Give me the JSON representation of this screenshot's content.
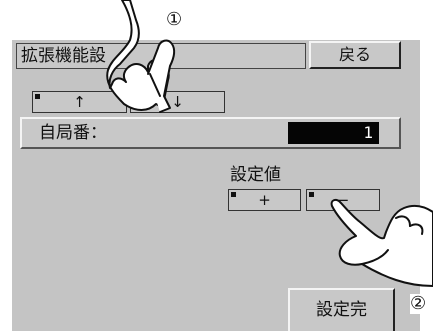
{
  "header": {
    "title": "拡張機能設",
    "back_label": "戻る"
  },
  "nav_buttons": {
    "up_label": "↑",
    "down_label": "↓"
  },
  "station_field": {
    "label": "自局番：",
    "value": "1"
  },
  "set_value": {
    "label": "設定値",
    "plus_label": "+",
    "minus_label": "−"
  },
  "footer": {
    "done_label": "設定完"
  },
  "callouts": {
    "step1": "①",
    "step2": "②"
  },
  "colors": {
    "panel": "#c4c4c4",
    "value_bg": "#050505",
    "value_text": "#ffffff"
  }
}
